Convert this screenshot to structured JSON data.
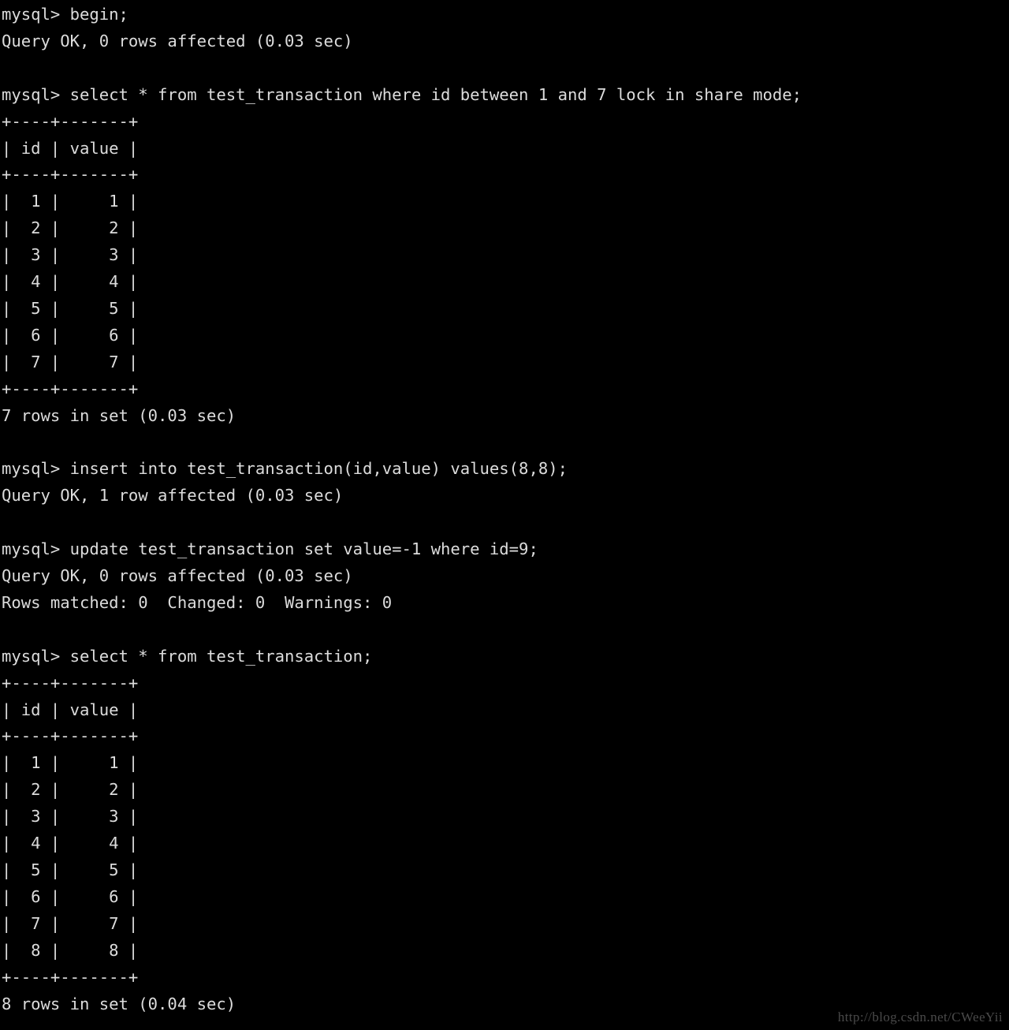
{
  "terminal": {
    "prompt": "mysql> ",
    "foreground_color": "#dcdcdc",
    "background_color": "#000000",
    "blocks": [
      {
        "command": "mysql> begin;",
        "result": "Query OK, 0 rows affected (0.03 sec)"
      },
      {
        "command": "mysql> select * from test_transaction where id between 1 and 7 lock in share mode;",
        "table": {
          "separator": "+----+-------+",
          "header": "| id | value |",
          "rows": [
            "|  1 |     1 |",
            "|  2 |     2 |",
            "|  3 |     3 |",
            "|  4 |     4 |",
            "|  5 |     5 |",
            "|  6 |     6 |",
            "|  7 |     7 |"
          ]
        },
        "result": "7 rows in set (0.03 sec)"
      },
      {
        "command": "mysql> insert into test_transaction(id,value) values(8,8);",
        "result": "Query OK, 1 row affected (0.03 sec)"
      },
      {
        "command": "mysql> update test_transaction set value=-1 where id=9;",
        "result": "Query OK, 0 rows affected (0.03 sec)",
        "result2": "Rows matched: 0  Changed: 0  Warnings: 0"
      },
      {
        "command": "mysql> select * from test_transaction;",
        "table": {
          "separator": "+----+-------+",
          "header": "| id | value |",
          "rows": [
            "|  1 |     1 |",
            "|  2 |     2 |",
            "|  3 |     3 |",
            "|  4 |     4 |",
            "|  5 |     5 |",
            "|  6 |     6 |",
            "|  7 |     7 |",
            "|  8 |     8 |"
          ]
        },
        "result": "8 rows in set (0.04 sec)"
      }
    ],
    "full_text": "mysql> begin;\nQuery OK, 0 rows affected (0.03 sec)\n\nmysql> select * from test_transaction where id between 1 and 7 lock in share mode;\n+----+-------+\n| id | value |\n+----+-------+\n|  1 |     1 |\n|  2 |     2 |\n|  3 |     3 |\n|  4 |     4 |\n|  5 |     5 |\n|  6 |     6 |\n|  7 |     7 |\n+----+-------+\n7 rows in set (0.03 sec)\n\nmysql> insert into test_transaction(id,value) values(8,8);\nQuery OK, 1 row affected (0.03 sec)\n\nmysql> update test_transaction set value=-1 where id=9;\nQuery OK, 0 rows affected (0.03 sec)\nRows matched: 0  Changed: 0  Warnings: 0\n\nmysql> select * from test_transaction;\n+----+-------+\n| id | value |\n+----+-------+\n|  1 |     1 |\n|  2 |     2 |\n|  3 |     3 |\n|  4 |     4 |\n|  5 |     5 |\n|  6 |     6 |\n|  7 |     7 |\n|  8 |     8 |\n+----+-------+\n8 rows in set (0.04 sec)"
  },
  "watermark": {
    "text": "http://blog.csdn.net/CWeeYii",
    "color": "#4a4a4a"
  }
}
